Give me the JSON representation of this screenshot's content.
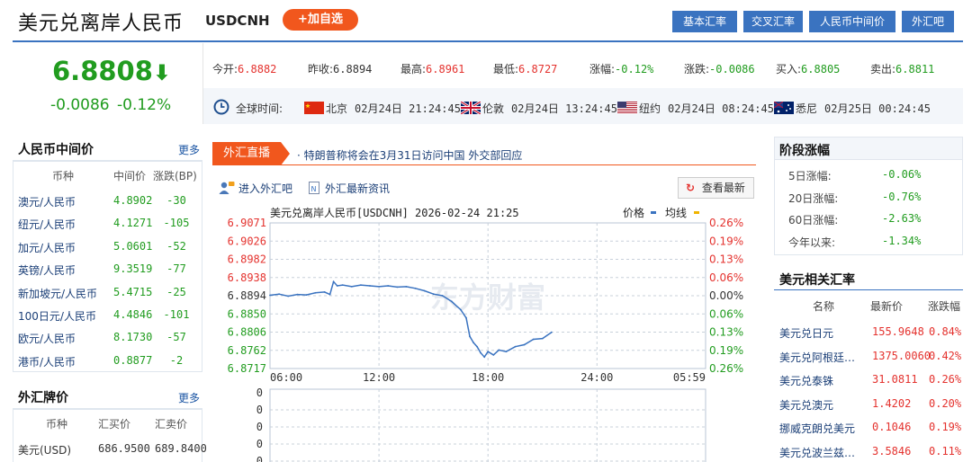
{
  "header": {
    "title": "美元兑离岸人民币",
    "code": "USDCNH",
    "add_label": "+加自选",
    "nav": [
      "基本汇率",
      "交叉汇率",
      "人民币中间价",
      "外汇吧"
    ]
  },
  "quote": {
    "price": "6.8808",
    "arrow": "⬇",
    "change": "-0.0086",
    "change_pct": "-0.12%"
  },
  "stats": [
    {
      "label": "今开:",
      "value": "6.8882",
      "color": "red"
    },
    {
      "label": "昨收:",
      "value": "6.8894",
      "color": "normal"
    },
    {
      "label": "最高:",
      "value": "6.8961",
      "color": "red"
    },
    {
      "label": "最低:",
      "value": "6.8727",
      "color": "red"
    },
    {
      "label": "涨幅:",
      "value": "-0.12%",
      "color": "green"
    },
    {
      "label": "涨跌:",
      "value": "-0.0086",
      "color": "green"
    },
    {
      "label": "买入:",
      "value": "6.8805",
      "color": "green"
    },
    {
      "label": "卖出:",
      "value": "6.8811",
      "color": "green"
    }
  ],
  "world_time": {
    "label": "全球时间:",
    "cities": [
      {
        "name": "北京",
        "time": "02月24日 21:24:45",
        "flag": "cn"
      },
      {
        "name": "伦敦",
        "time": "02月24日 13:24:45",
        "flag": "uk"
      },
      {
        "name": "纽约",
        "time": "02月24日 08:24:45",
        "flag": "us"
      },
      {
        "name": "悉尼",
        "time": "02月25日 00:24:45",
        "flag": "au"
      }
    ]
  },
  "rmb_mid": {
    "title": "人民币中间价",
    "more": "更多",
    "headers": [
      "币种",
      "中间价",
      "涨跌(BP)"
    ],
    "rows": [
      [
        "澳元/人民币",
        "4.8902",
        "-30"
      ],
      [
        "纽元/人民币",
        "4.1271",
        "-105"
      ],
      [
        "加元/人民币",
        "5.0601",
        "-52"
      ],
      [
        "英镑/人民币",
        "9.3519",
        "-77"
      ],
      [
        "新加坡元/人民币",
        "5.4715",
        "-25"
      ],
      [
        "100日元/人民币",
        "4.4846",
        "-101"
      ],
      [
        "欧元/人民币",
        "8.1730",
        "-57"
      ],
      [
        "港币/人民币",
        "0.8877",
        "-2"
      ]
    ]
  },
  "fx_board": {
    "title": "外汇牌价",
    "more": "更多",
    "headers": [
      "币种",
      "汇买价",
      "汇卖价"
    ],
    "rows": [
      [
        "美元(USD)",
        "686.9500",
        "689.8400"
      ]
    ]
  },
  "live": {
    "tab": "外汇直播",
    "headline": "· 特朗普称将会在3月31日访问中国 外交部回应",
    "link1": "进入外汇吧",
    "link2": "外汇最新资讯",
    "refresh": "查看最新"
  },
  "chart_data": {
    "type": "line",
    "title": "美元兑离岸人民币[USDCNH] 2026-02-24 21:25",
    "legend": [
      {
        "name": "价格",
        "color": "#3a73c0"
      },
      {
        "name": "均线",
        "color": "#f0b400"
      }
    ],
    "y_ticks": [
      "6.9071",
      "6.9026",
      "6.8982",
      "6.8938",
      "6.8894",
      "6.8850",
      "6.8806",
      "6.8762",
      "6.8717"
    ],
    "y_pct": [
      "0.26%",
      "0.19%",
      "0.13%",
      "0.06%",
      "0.00%",
      "0.06%",
      "0.13%",
      "0.19%",
      "0.26%"
    ],
    "x_ticks": [
      "06:00",
      "12:00",
      "18:00",
      "24:00",
      "05:59"
    ],
    "x_tick_hours": [
      0,
      6,
      12,
      18,
      23.98
    ],
    "ylim": [
      6.8717,
      6.9071
    ],
    "xlim_hours": [
      0,
      23.98
    ],
    "series": [
      {
        "color": "#3a73c0",
        "x_hours": [
          0,
          0.5,
          1,
          1.5,
          2,
          2.5,
          3,
          3.3,
          3.5,
          3.7,
          4,
          4.5,
          5,
          5.5,
          6,
          6.5,
          7,
          7.5,
          8,
          8.5,
          9,
          9.5,
          10,
          10.5,
          10.8,
          11,
          11.2,
          11.4,
          11.6,
          11.8,
          12,
          12.3,
          12.6,
          13,
          13.5,
          14,
          14.5,
          15,
          15.5
        ],
        "values": [
          6.8895,
          6.8898,
          6.8893,
          6.8897,
          6.8896,
          6.8901,
          6.8903,
          6.8897,
          6.8928,
          6.8918,
          6.892,
          6.8916,
          6.892,
          6.8918,
          6.8916,
          6.8918,
          6.8915,
          6.8916,
          6.8912,
          6.8906,
          6.8898,
          6.8894,
          6.888,
          6.886,
          6.884,
          6.8795,
          6.878,
          6.877,
          6.8755,
          6.8745,
          6.8758,
          6.875,
          6.8762,
          6.8758,
          6.877,
          6.8775,
          6.8788,
          6.879,
          6.8805
        ]
      }
    ],
    "volume_ticks": [
      "0",
      "0",
      "0",
      "0",
      "0"
    ],
    "watermark": "东方财富"
  },
  "period": {
    "title": "阶段涨幅",
    "rows": [
      [
        "5日涨幅:",
        "-0.06%"
      ],
      [
        "20日涨幅:",
        "-0.76%"
      ],
      [
        "60日涨幅:",
        "-2.63%"
      ],
      [
        "今年以来:",
        "-1.34%"
      ]
    ]
  },
  "related": {
    "title": "美元相关汇率",
    "headers": [
      "名称",
      "最新价",
      "涨跌幅"
    ],
    "rows": [
      [
        "美元兑日元",
        "155.9648",
        "0.84%"
      ],
      [
        "美元兑阿根廷…",
        "1375.0060",
        "0.42%"
      ],
      [
        "美元兑泰铢",
        "31.0811",
        "0.26%"
      ],
      [
        "美元兑澳元",
        "1.4202",
        "0.20%"
      ],
      [
        "挪威克朗兑美元",
        "0.1046",
        "0.19%"
      ],
      [
        "美元兑波兰兹…",
        "3.5846",
        "0.11%"
      ]
    ]
  }
}
